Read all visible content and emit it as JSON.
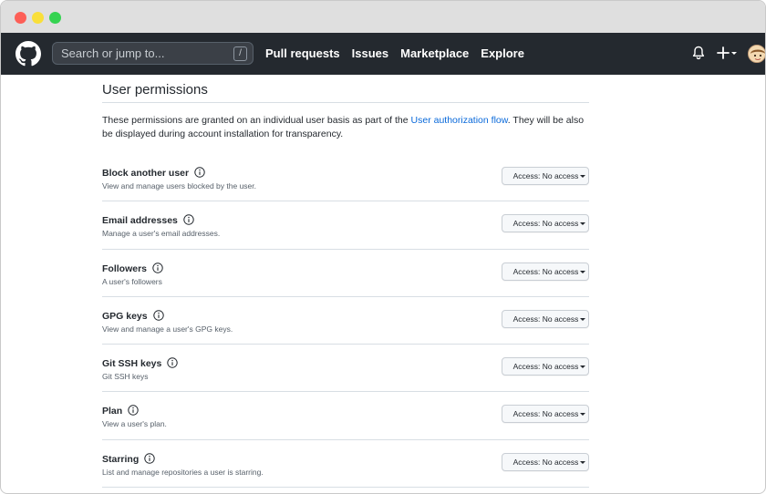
{
  "header": {
    "search_placeholder": "Search or jump to...",
    "search_shortcut": "/",
    "nav": [
      "Pull requests",
      "Issues",
      "Marketplace",
      "Explore"
    ]
  },
  "page": {
    "title": "User permissions",
    "intro_before": "These permissions are granted on an individual user basis as part of the ",
    "intro_link": "User authorization flow",
    "intro_after": ". They will be also be displayed during account installation for transparency."
  },
  "permissions": [
    {
      "name": "Block another user",
      "description": "View and manage users blocked by the user.",
      "access": "Access: No access"
    },
    {
      "name": "Email addresses",
      "description": "Manage a user's email addresses.",
      "access": "Access: No access"
    },
    {
      "name": "Followers",
      "description": "A user's followers",
      "access": "Access: No access"
    },
    {
      "name": "GPG keys",
      "description": "View and manage a user's GPG keys.",
      "access": "Access: No access"
    },
    {
      "name": "Git SSH keys",
      "description": "Git SSH keys",
      "access": "Access: No access"
    },
    {
      "name": "Plan",
      "description": "View a user's plan.",
      "access": "Access: No access"
    },
    {
      "name": "Starring",
      "description": "List and manage repositories a user is starring.",
      "access": "Access: No access"
    }
  ],
  "colors": {
    "header_bg": "#24292f",
    "link": "#0969da",
    "traffic_red": "#fd5f57",
    "traffic_yellow": "#f9df3a",
    "traffic_green": "#35d351"
  },
  "icons": {
    "logo": "github-mark-icon",
    "notifications": "bell-icon",
    "create": "plus-icon",
    "info": "info-icon"
  }
}
